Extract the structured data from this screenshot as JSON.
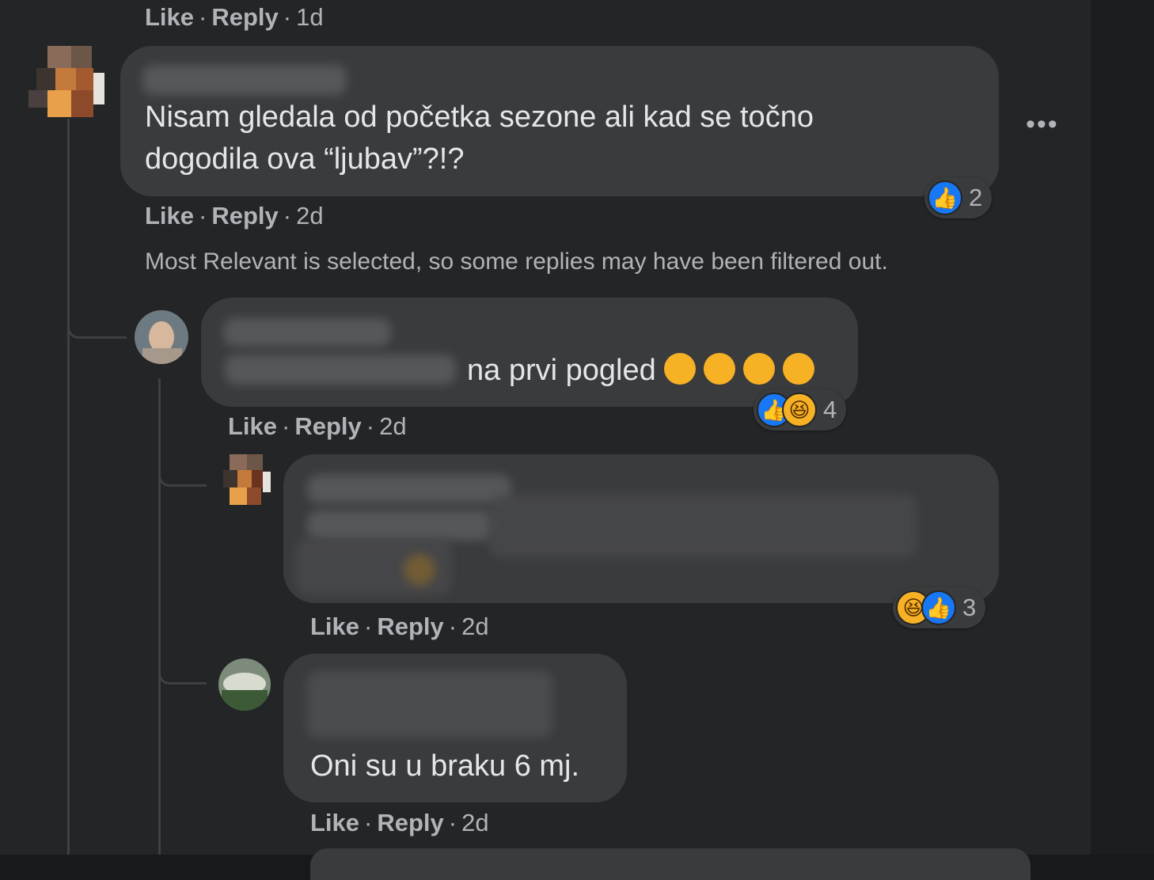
{
  "top_actions": {
    "like": "Like",
    "reply": "Reply",
    "time": "1d"
  },
  "comment1": {
    "text_line1": "Nisam gledala od početka sezone ali kad se točno",
    "text_line2": "dogodila ova “ljubav”?!?",
    "reaction_count": "2",
    "actions": {
      "like": "Like",
      "reply": "Reply",
      "time": "2d"
    },
    "more_icon": "more-options-icon"
  },
  "filter_notice": "Most Relevant is selected, so some replies may have been filtered out.",
  "reply1": {
    "text": "na prvi pogled",
    "emojis": [
      "smirking-face",
      "smirking-face",
      "upside-down-face",
      "upside-down-face"
    ],
    "reaction_count": "4",
    "actions": {
      "like": "Like",
      "reply": "Reply",
      "time": "2d"
    }
  },
  "reply2": {
    "reaction_count": "3",
    "actions": {
      "like": "Like",
      "reply": "Reply",
      "time": "2d"
    }
  },
  "reply3": {
    "text": "Oni su u braku 6 mj.",
    "actions": {
      "like": "Like",
      "reply": "Reply",
      "time": "2d"
    }
  },
  "colors": {
    "background": "#242526",
    "bubble": "#3a3b3c",
    "text": "#e4e6eb",
    "secondary_text": "#b0b3b8",
    "like_blue": "#1877f2",
    "haha_yellow": "#f7b125"
  }
}
